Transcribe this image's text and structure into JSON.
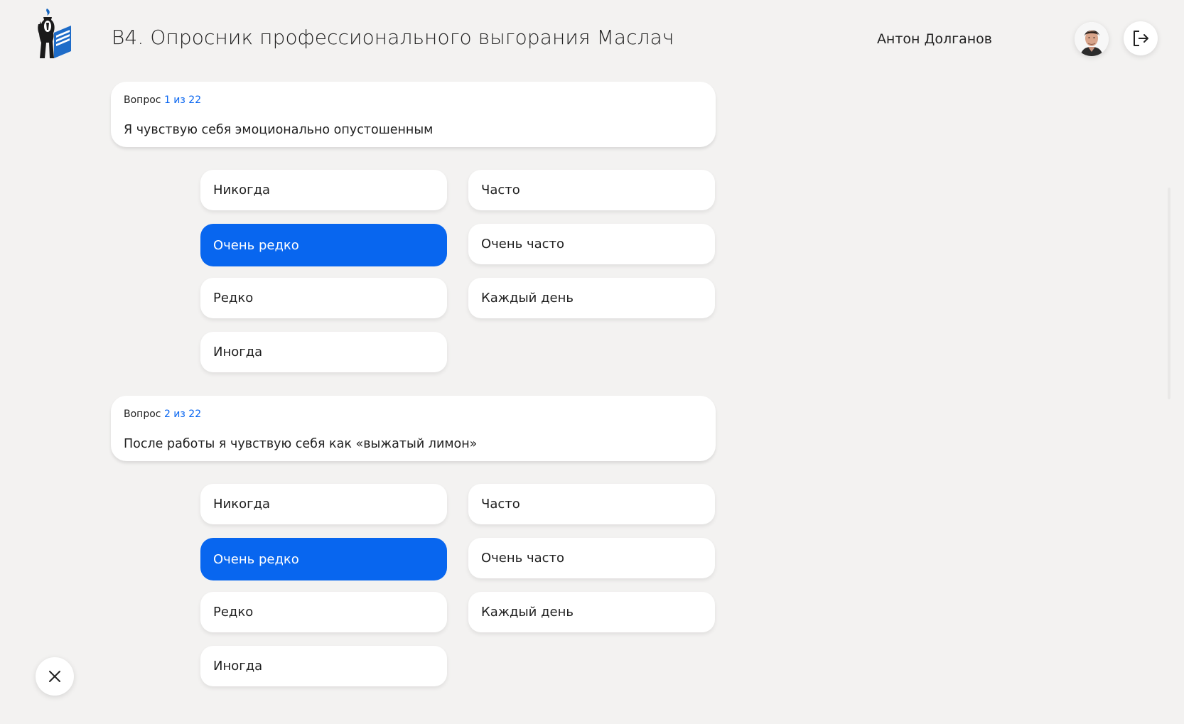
{
  "header": {
    "title": "B4. Опросник профессионального выгорания Маслач",
    "user_name": "Антон Долганов"
  },
  "questions": [
    {
      "counter_label": "Вопрос",
      "counter_value": "1 из 22",
      "text": "Я чувствую себя эмоционально опустошенным",
      "selected": "Очень редко"
    },
    {
      "counter_label": "Вопрос",
      "counter_value": "2 из 22",
      "text": "После работы я чувствую себя как «выжатый лимон»",
      "selected": "Очень редко"
    }
  ],
  "answers": {
    "never": "Никогда",
    "very_rarely": "Очень редко",
    "rarely": "Редко",
    "sometimes": "Иногда",
    "often": "Часто",
    "very_often": "Очень часто",
    "every_day": "Каждый день"
  },
  "icons": {
    "logo": "emblem-logo",
    "avatar": "user-avatar",
    "logout": "logout-icon",
    "close": "close-icon"
  },
  "colors": {
    "accent": "#0866ef",
    "background": "#f3f2f1",
    "card": "#ffffff"
  }
}
